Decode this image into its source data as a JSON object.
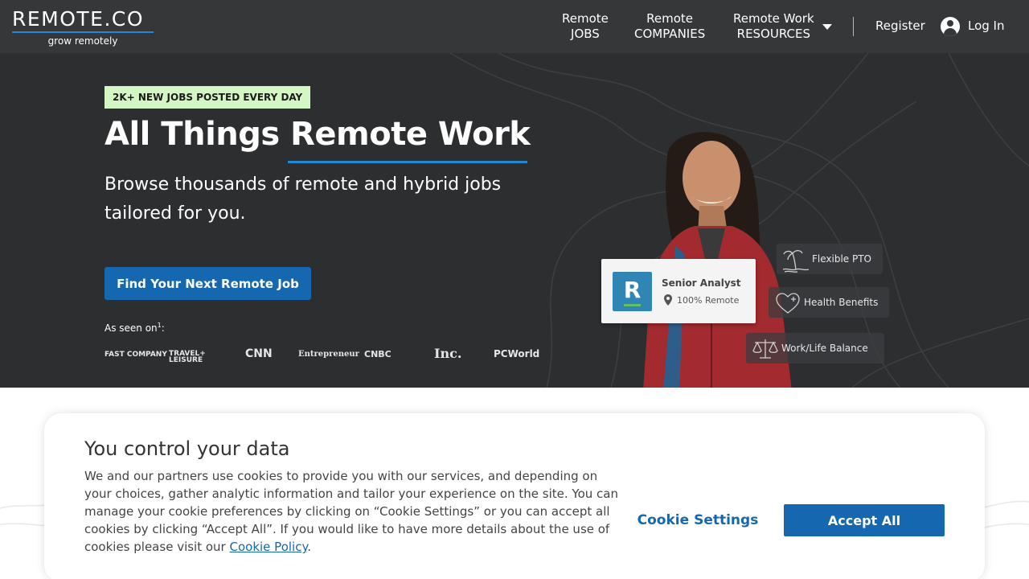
{
  "nav": {
    "logo_text": "REMOTE.CO",
    "logo_tagline": "grow remotely",
    "items": [
      {
        "line1": "Remote",
        "line2": "JOBS"
      },
      {
        "line1": "Remote",
        "line2": "COMPANIES"
      },
      {
        "line1": "Remote Work",
        "line2": "RESOURCES"
      }
    ],
    "register": "Register",
    "login": "Log In"
  },
  "hero": {
    "badge": "2K+ NEW JOBS POSTED EVERY DAY",
    "headline": "All Things Remote Work",
    "subhead": "Browse thousands of remote and hybrid jobs tailored for you.",
    "cta": "Find Your Next Remote Job",
    "as_seen_on": "As seen on",
    "as_seen_on_sup": "1",
    "press_logos": [
      "FAST COMPANY",
      "TRAVEL+ LEISURE",
      "CNN",
      "Entrepreneur",
      "CNBC",
      "Inc.",
      "PCWorld"
    ],
    "job_card": {
      "logo_letter": "R",
      "title": "Senior Analyst",
      "location": "100% Remote"
    },
    "perks": [
      "Flexible PTO",
      "Health Benefits",
      "Work/Life Balance"
    ]
  },
  "cookie": {
    "title": "You control your data",
    "text": "We and our partners use cookies to provide you with our services, and depending on your choices, gather analytic information and tailor your experience on the site. You can manage your cookie preferences by clicking on “Cookie Settings” or you can accept all cookies by clicking “Accept All”. If you would like to have more details about the use of cookies please visit our",
    "policy_link": "Cookie Policy",
    "settings_button": "Cookie Settings",
    "accept_button": "Accept All"
  },
  "colors": {
    "nav_bg": "#353739",
    "hero_bg": "#2c2e30",
    "accent_blue": "#1568b0",
    "badge_green": "#d4f5c4"
  }
}
